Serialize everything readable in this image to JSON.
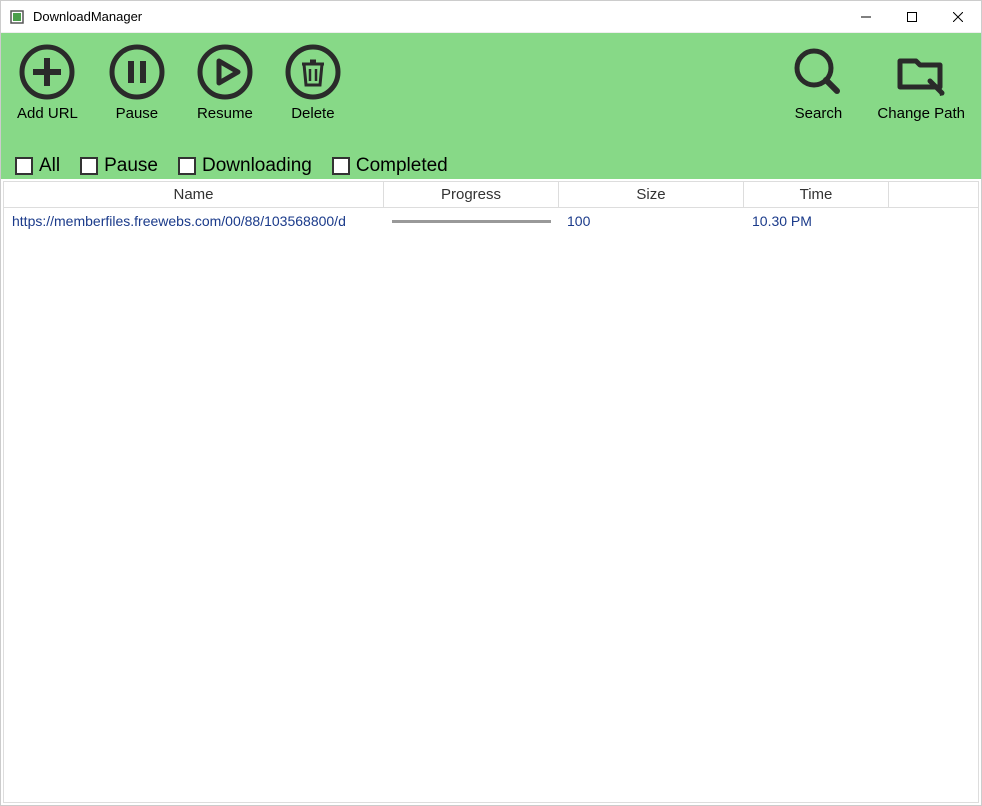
{
  "window": {
    "title": "DownloadManager"
  },
  "toolbar": {
    "add_url": "Add URL",
    "pause": "Pause",
    "resume": "Resume",
    "delete": "Delete",
    "search": "Search",
    "change_path": "Change Path"
  },
  "filters": {
    "all": "All",
    "pause": "Pause",
    "downloading": "Downloading",
    "completed": "Completed"
  },
  "table": {
    "headers": {
      "name": "Name",
      "progress": "Progress",
      "size": "Size",
      "time": "Time"
    },
    "rows": [
      {
        "name": "https://memberfiles.freewebs.com/00/88/103568800/d",
        "progress": 100,
        "size": "100",
        "time": "10.30 PM"
      }
    ]
  },
  "colors": {
    "accent": "#87d987",
    "link": "#1a3a8a"
  }
}
